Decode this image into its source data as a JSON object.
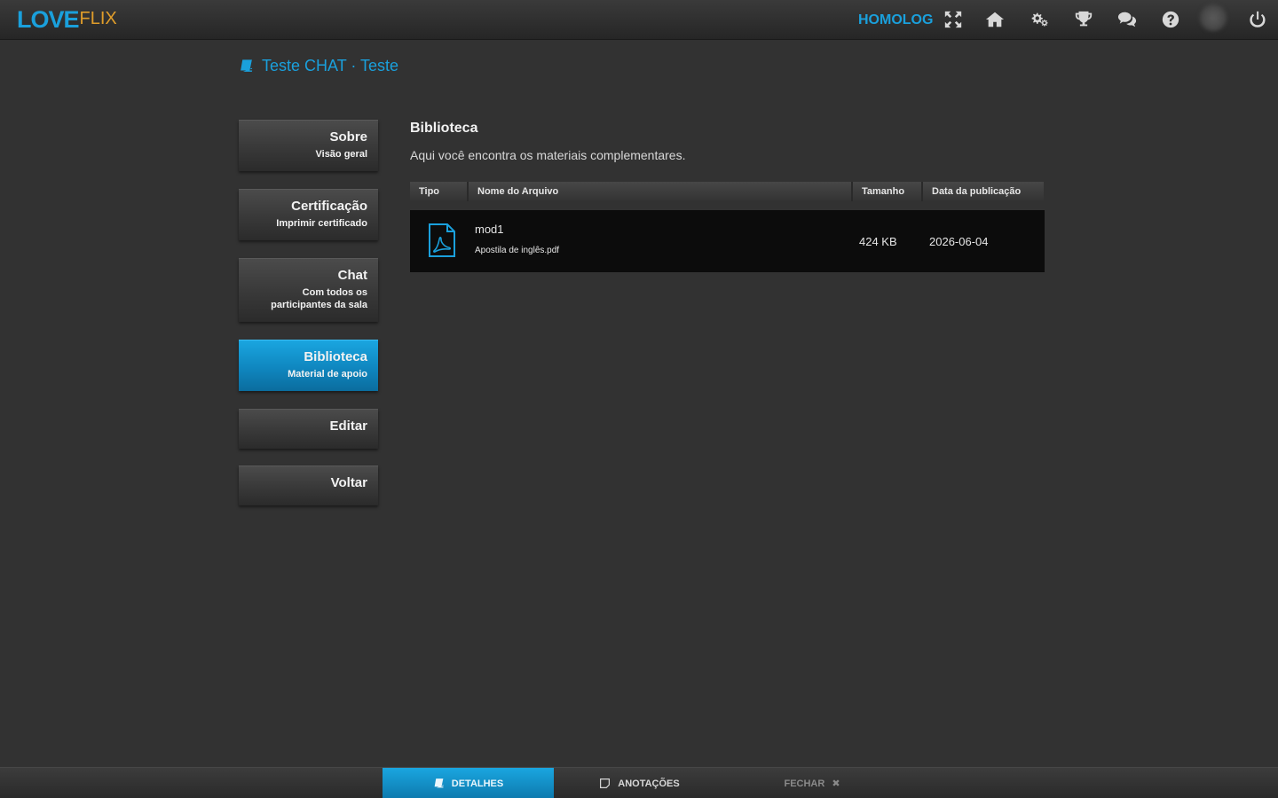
{
  "header": {
    "logo_love": "LOVE",
    "logo_flix": "FLIX",
    "environment": "HOMOLOG",
    "icons": [
      "fullscreen-icon",
      "home-icon",
      "settings-icon",
      "trophy-icon",
      "chat-icon",
      "help-icon",
      "power-icon"
    ]
  },
  "page": {
    "title": "Teste CHAT · Teste",
    "title_icon": "book-icon"
  },
  "sidebar": {
    "items": [
      {
        "title": "Sobre",
        "subtitle": "Visão geral",
        "active": false
      },
      {
        "title": "Certificação",
        "subtitle": "Imprimir certificado",
        "active": false
      },
      {
        "title": "Chat",
        "subtitle": "Com todos os participantes da sala",
        "active": false
      },
      {
        "title": "Biblioteca",
        "subtitle": "Material de apoio",
        "active": true
      },
      {
        "title": "Editar",
        "subtitle": "",
        "active": false
      },
      {
        "title": "Voltar",
        "subtitle": "",
        "active": false
      }
    ]
  },
  "library": {
    "title": "Biblioteca",
    "description": "Aqui você encontra os materiais complementares.",
    "columns": [
      "Tipo",
      "Nome do Arquivo",
      "Tamanho",
      "Data da publicação"
    ],
    "rows": [
      {
        "type_icon": "pdf-file-icon",
        "name": "mod1",
        "filename": "Apostila de inglês.pdf",
        "size": "424 KB",
        "date": "2026-06-04"
      }
    ]
  },
  "footer": {
    "details_label": "DETALHES",
    "notes_label": "ANOTAÇÕES",
    "close_label": "FECHAR",
    "close_symbol": "✖"
  },
  "colors": {
    "accent": "#1aa0dc",
    "logo_flix": "#e09d2a",
    "background": "#323232"
  }
}
